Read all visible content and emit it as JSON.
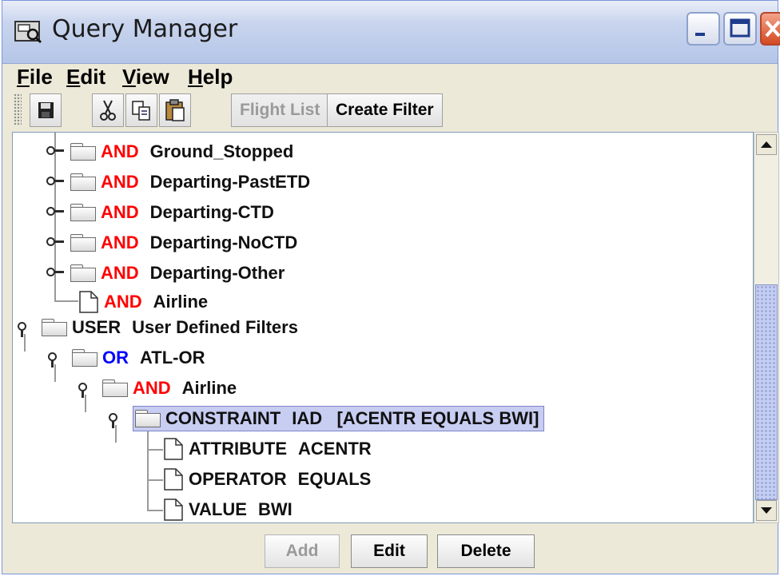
{
  "window": {
    "title": "Query Manager"
  },
  "menu": [
    {
      "label": "File",
      "underline": "F",
      "rest": "ile"
    },
    {
      "label": "Edit",
      "underline": "E",
      "rest": "dit"
    },
    {
      "label": "View",
      "underline": "V",
      "rest": "iew"
    },
    {
      "label": "Help",
      "underline": "H",
      "rest": "elp"
    }
  ],
  "toolbar": {
    "icons": [
      "save-icon",
      "cut-icon",
      "copy-icon",
      "paste-icon"
    ],
    "flight_list_label": "Flight List",
    "create_filter_label": "Create Filter"
  },
  "tree": [
    {
      "type": "folder",
      "handle": "collapsed",
      "keyword": "AND",
      "keyword_color": "red",
      "label": "Ground_Stopped"
    },
    {
      "type": "folder",
      "handle": "collapsed",
      "keyword": "AND",
      "keyword_color": "red",
      "label": "Departing-PastETD"
    },
    {
      "type": "folder",
      "handle": "collapsed",
      "keyword": "AND",
      "keyword_color": "red",
      "label": "Departing-CTD"
    },
    {
      "type": "folder",
      "handle": "collapsed",
      "keyword": "AND",
      "keyword_color": "red",
      "label": "Departing-NoCTD"
    },
    {
      "type": "folder",
      "handle": "collapsed",
      "keyword": "AND",
      "keyword_color": "red",
      "label": "Departing-Other"
    },
    {
      "type": "leaf",
      "keyword": "AND",
      "keyword_color": "red",
      "label": "Airline"
    },
    {
      "type": "folder",
      "handle": "expanded",
      "keyword": "USER",
      "keyword_color": "black",
      "label": "User Defined Filters"
    },
    {
      "type": "folder",
      "handle": "expanded",
      "keyword": "OR",
      "keyword_color": "blue",
      "label": "ATL-OR"
    },
    {
      "type": "folder",
      "handle": "expanded",
      "keyword": "AND",
      "keyword_color": "red",
      "label": "Airline"
    },
    {
      "type": "folder",
      "handle": "expanded",
      "keyword": "CONSTRAINT",
      "keyword_color": "black",
      "label": "IAD   [ACENTR EQUALS BWI]",
      "selected": true
    },
    {
      "type": "leaf",
      "keyword": "ATTRIBUTE",
      "keyword_color": "black",
      "label": "ACENTR"
    },
    {
      "type": "leaf",
      "keyword": "OPERATOR",
      "keyword_color": "black",
      "label": "EQUALS"
    },
    {
      "type": "leaf",
      "keyword": "VALUE",
      "keyword_color": "black",
      "label": "BWI"
    }
  ],
  "buttons": {
    "add": "Add",
    "edit": "Edit",
    "delete": "Delete"
  },
  "colors": {
    "and_keyword": "#ff0000",
    "or_keyword": "#0000ff",
    "selection": "#c8cdf2",
    "titlebar": "#c9d5ee"
  }
}
